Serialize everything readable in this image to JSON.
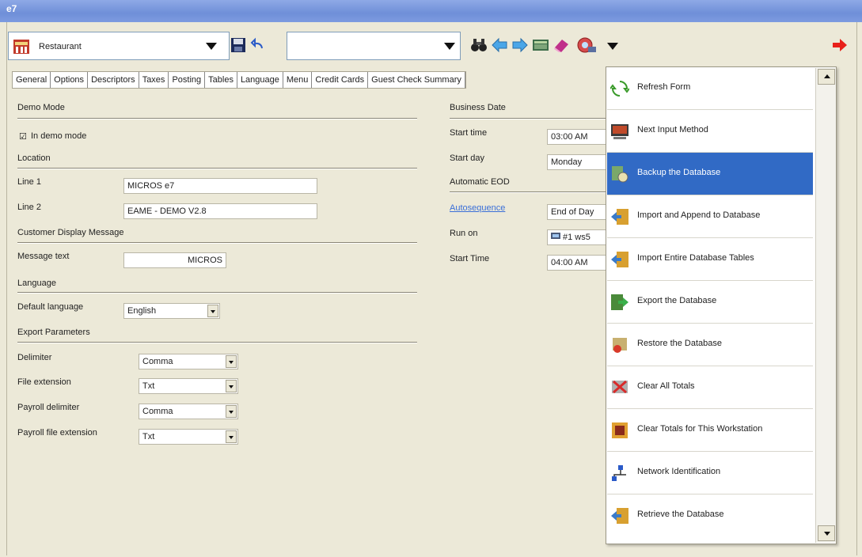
{
  "window": {
    "title": "e7"
  },
  "toolbar": {
    "module_combo_value": "Restaurant",
    "record_combo_value": ""
  },
  "tabs": [
    {
      "label": "General"
    },
    {
      "label": "Options"
    },
    {
      "label": "Descriptors"
    },
    {
      "label": "Taxes"
    },
    {
      "label": "Posting"
    },
    {
      "label": "Tables"
    },
    {
      "label": "Language"
    },
    {
      "label": "Menu"
    },
    {
      "label": "Credit Cards"
    },
    {
      "label": "Guest Check Summary"
    }
  ],
  "demo": {
    "section": "Demo Mode",
    "checkbox_label": "In demo mode",
    "checked": true
  },
  "location": {
    "section": "Location",
    "line1_label": "Line 1",
    "line1_value": "MICROS e7",
    "line2_label": "Line 2",
    "line2_value": "EAME - DEMO V2.8"
  },
  "customer_display": {
    "section": "Customer Display Message",
    "message_label": "Message text",
    "message_value": "MICROS"
  },
  "language": {
    "section": "Language",
    "default_label": "Default language",
    "default_value": "English"
  },
  "export": {
    "section": "Export Parameters",
    "delimiter_label": "Delimiter",
    "delimiter_value": "Comma",
    "file_ext_label": "File extension",
    "file_ext_value": "Txt",
    "payroll_delim_label": "Payroll delimiter",
    "payroll_delim_value": "Comma",
    "payroll_ext_label": "Payroll file extension",
    "payroll_ext_value": "Txt"
  },
  "business_date": {
    "section": "Business Date",
    "start_time_label": "Start time",
    "start_time_value": "03:00 AM",
    "start_day_label": "Start day",
    "start_day_value": "Monday"
  },
  "automatic_eod": {
    "section": "Automatic EOD",
    "autosequence_label": "Autosequence",
    "autosequence_value": "End of Day",
    "run_on_label": "Run on",
    "run_on_value": "#1 ws5",
    "start_time_label": "Start Time",
    "start_time_value": "04:00 AM"
  },
  "menu": {
    "items": [
      {
        "label": "Refresh Form",
        "icon": "refresh-icon"
      },
      {
        "label": "Next Input Method",
        "icon": "input-method-icon"
      },
      {
        "label": "Backup the Database",
        "icon": "backup-icon",
        "selected": true
      },
      {
        "label": "Import and Append to Database",
        "icon": "import-append-icon"
      },
      {
        "label": "Import Entire Database Tables",
        "icon": "import-tables-icon"
      },
      {
        "label": "Export the Database",
        "icon": "export-icon"
      },
      {
        "label": "Restore the Database",
        "icon": "restore-icon"
      },
      {
        "label": "Clear All Totals",
        "icon": "clear-totals-icon"
      },
      {
        "label": "Clear Totals for This Workstation",
        "icon": "clear-workstation-icon"
      },
      {
        "label": "Network Identification",
        "icon": "network-icon"
      },
      {
        "label": "Retrieve the Database",
        "icon": "retrieve-icon"
      }
    ]
  },
  "colors": {
    "selection": "#316ac5",
    "link": "#3a6fd8",
    "exit_arrow": "#e8201a"
  }
}
